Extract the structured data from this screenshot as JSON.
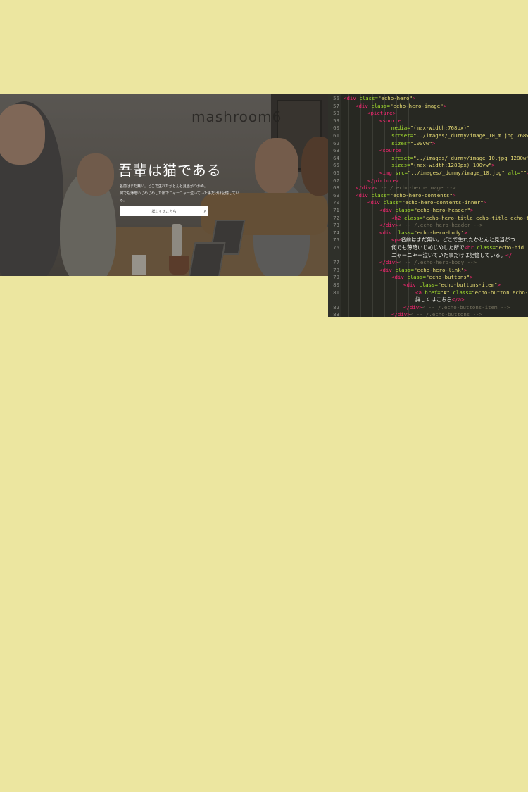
{
  "hero": {
    "logo_text": "mashroom6",
    "title": "吾輩は猫である",
    "body_line1": "名前はまだ無い。どこで生れたかとんと見当がつかぬ。",
    "body_line2": "何でも薄暗いじめじめした所でニャーニャー泣いていた事だけは記憶している。",
    "button_label": "詳しくはこちら",
    "button_icon": "chevron-right-icon"
  },
  "editor": {
    "lines": [
      {
        "n": "56",
        "indent": 0,
        "parts": [
          [
            "tag",
            "<div "
          ],
          [
            "attr",
            "class="
          ],
          [
            "str",
            "\"echo-hero\""
          ],
          [
            "tag",
            ">"
          ]
        ]
      },
      {
        "n": "57",
        "indent": 1,
        "parts": [
          [
            "tag",
            "<div "
          ],
          [
            "attr",
            "class="
          ],
          [
            "str",
            "\"echo-hero-image\""
          ],
          [
            "tag",
            ">"
          ]
        ]
      },
      {
        "n": "58",
        "indent": 2,
        "parts": [
          [
            "tag",
            "<picture>"
          ]
        ]
      },
      {
        "n": "59",
        "indent": 3,
        "parts": [
          [
            "tag",
            "<source"
          ]
        ]
      },
      {
        "n": "60",
        "indent": 4,
        "parts": [
          [
            "attr",
            "media="
          ],
          [
            "str",
            "\"(max-width:768px)\""
          ]
        ]
      },
      {
        "n": "61",
        "indent": 4,
        "parts": [
          [
            "attr",
            "srcset="
          ],
          [
            "str",
            "\"../images/_dummy/image_10_m.jpg 768w\""
          ]
        ]
      },
      {
        "n": "62",
        "indent": 4,
        "parts": [
          [
            "attr",
            "sizes="
          ],
          [
            "str",
            "\"100vw\""
          ],
          [
            "tag",
            ">"
          ]
        ]
      },
      {
        "n": "63",
        "indent": 3,
        "parts": [
          [
            "tag",
            "<source"
          ]
        ]
      },
      {
        "n": "64",
        "indent": 4,
        "parts": [
          [
            "attr",
            "srcset="
          ],
          [
            "str",
            "\"../images/_dummy/image_10.jpg 1280w\""
          ]
        ]
      },
      {
        "n": "65",
        "indent": 4,
        "parts": [
          [
            "attr",
            "sizes="
          ],
          [
            "str",
            "\"(max-width:1280px) 100vw\""
          ],
          [
            "tag",
            ">"
          ]
        ]
      },
      {
        "n": "66",
        "indent": 3,
        "parts": [
          [
            "tag",
            "<img "
          ],
          [
            "attr",
            "src="
          ],
          [
            "str",
            "\"../images/_dummy/image_10.jpg\" "
          ],
          [
            "attr",
            "alt="
          ],
          [
            "str",
            "\"\""
          ],
          [
            "tag",
            ">"
          ]
        ]
      },
      {
        "n": "67",
        "indent": 2,
        "parts": [
          [
            "tag",
            "</picture>"
          ]
        ]
      },
      {
        "n": "68",
        "indent": 1,
        "parts": [
          [
            "tag",
            "</div>"
          ],
          [
            "cmt",
            "<!-- /.echo-hero-image -->"
          ]
        ]
      },
      {
        "n": "69",
        "indent": 1,
        "parts": [
          [
            "tag",
            "<div "
          ],
          [
            "attr",
            "class="
          ],
          [
            "str",
            "\"echo-hero-contents\""
          ],
          [
            "tag",
            ">"
          ]
        ]
      },
      {
        "n": "70",
        "indent": 2,
        "parts": [
          [
            "tag",
            "<div "
          ],
          [
            "attr",
            "class="
          ],
          [
            "str",
            "\"echo-hero-contents-inner\""
          ],
          [
            "tag",
            ">"
          ]
        ]
      },
      {
        "n": "71",
        "indent": 3,
        "parts": [
          [
            "tag",
            "<div "
          ],
          [
            "attr",
            "class="
          ],
          [
            "str",
            "\"echo-hero-header\""
          ],
          [
            "tag",
            ">"
          ]
        ]
      },
      {
        "n": "72",
        "indent": 4,
        "parts": [
          [
            "tag",
            "<h2 "
          ],
          [
            "attr",
            "class="
          ],
          [
            "str",
            "\"echo-hero-title echo-title echo-titl"
          ]
        ]
      },
      {
        "n": "73",
        "indent": 3,
        "parts": [
          [
            "tag",
            "</div>"
          ],
          [
            "cmt",
            "<!-- /.echo-hero-header -->"
          ]
        ]
      },
      {
        "n": "74",
        "indent": 3,
        "parts": [
          [
            "tag",
            "<div "
          ],
          [
            "attr",
            "class="
          ],
          [
            "str",
            "\"echo-hero-body\""
          ],
          [
            "tag",
            ">"
          ]
        ]
      },
      {
        "n": "75",
        "indent": 4,
        "parts": [
          [
            "tag",
            "<p>"
          ],
          [
            "txt",
            "名前はまだ無い。どこで生れたかとんと見当がつ"
          ]
        ]
      },
      {
        "n": "76",
        "indent": 4,
        "parts": [
          [
            "txt",
            "何でも薄暗いじめじめした所で"
          ],
          [
            "tag",
            "<br "
          ],
          [
            "attr",
            "class="
          ],
          [
            "str",
            "\"echo-hid"
          ]
        ]
      },
      {
        "n": "",
        "indent": 4,
        "parts": [
          [
            "txt",
            "ニャーニャー泣いていた事だけは記憶している。"
          ],
          [
            "tag",
            "</"
          ]
        ]
      },
      {
        "n": "77",
        "indent": 3,
        "parts": [
          [
            "tag",
            "</div>"
          ],
          [
            "cmt",
            "<!-- /.echo-hero-body -->"
          ]
        ]
      },
      {
        "n": "78",
        "indent": 3,
        "parts": [
          [
            "tag",
            "<div "
          ],
          [
            "attr",
            "class="
          ],
          [
            "str",
            "\"echo-hero-link\""
          ],
          [
            "tag",
            ">"
          ]
        ]
      },
      {
        "n": "79",
        "indent": 4,
        "parts": [
          [
            "tag",
            "<div "
          ],
          [
            "attr",
            "class="
          ],
          [
            "str",
            "\"echo-buttons\""
          ],
          [
            "tag",
            ">"
          ]
        ]
      },
      {
        "n": "80",
        "indent": 5,
        "parts": [
          [
            "tag",
            "<div "
          ],
          [
            "attr",
            "class="
          ],
          [
            "str",
            "\"echo-buttons-item\""
          ],
          [
            "tag",
            ">"
          ]
        ]
      },
      {
        "n": "81",
        "indent": 6,
        "parts": [
          [
            "tag",
            "<a "
          ],
          [
            "attr",
            "href="
          ],
          [
            "str",
            "\"#\" "
          ],
          [
            "attr",
            "class="
          ],
          [
            "str",
            "\"echo-button echo-but"
          ]
        ]
      },
      {
        "n": "",
        "indent": 6,
        "parts": [
          [
            "txt",
            "詳しくはこちら"
          ],
          [
            "tag",
            "</a>"
          ]
        ]
      },
      {
        "n": "82",
        "indent": 5,
        "parts": [
          [
            "tag",
            "</div>"
          ],
          [
            "cmt",
            "<!-- /.echo-buttons-item -->"
          ]
        ]
      },
      {
        "n": "83",
        "indent": 4,
        "parts": [
          [
            "tag",
            "</div>"
          ],
          [
            "cmt",
            "<!-- /.echo-buttons -->"
          ]
        ]
      }
    ]
  },
  "colors": {
    "page_background": "#ece6a0",
    "editor_background": "#272822",
    "tag": "#f92672",
    "attribute": "#a6e22e",
    "string": "#e6db74",
    "comment": "#75715e"
  }
}
